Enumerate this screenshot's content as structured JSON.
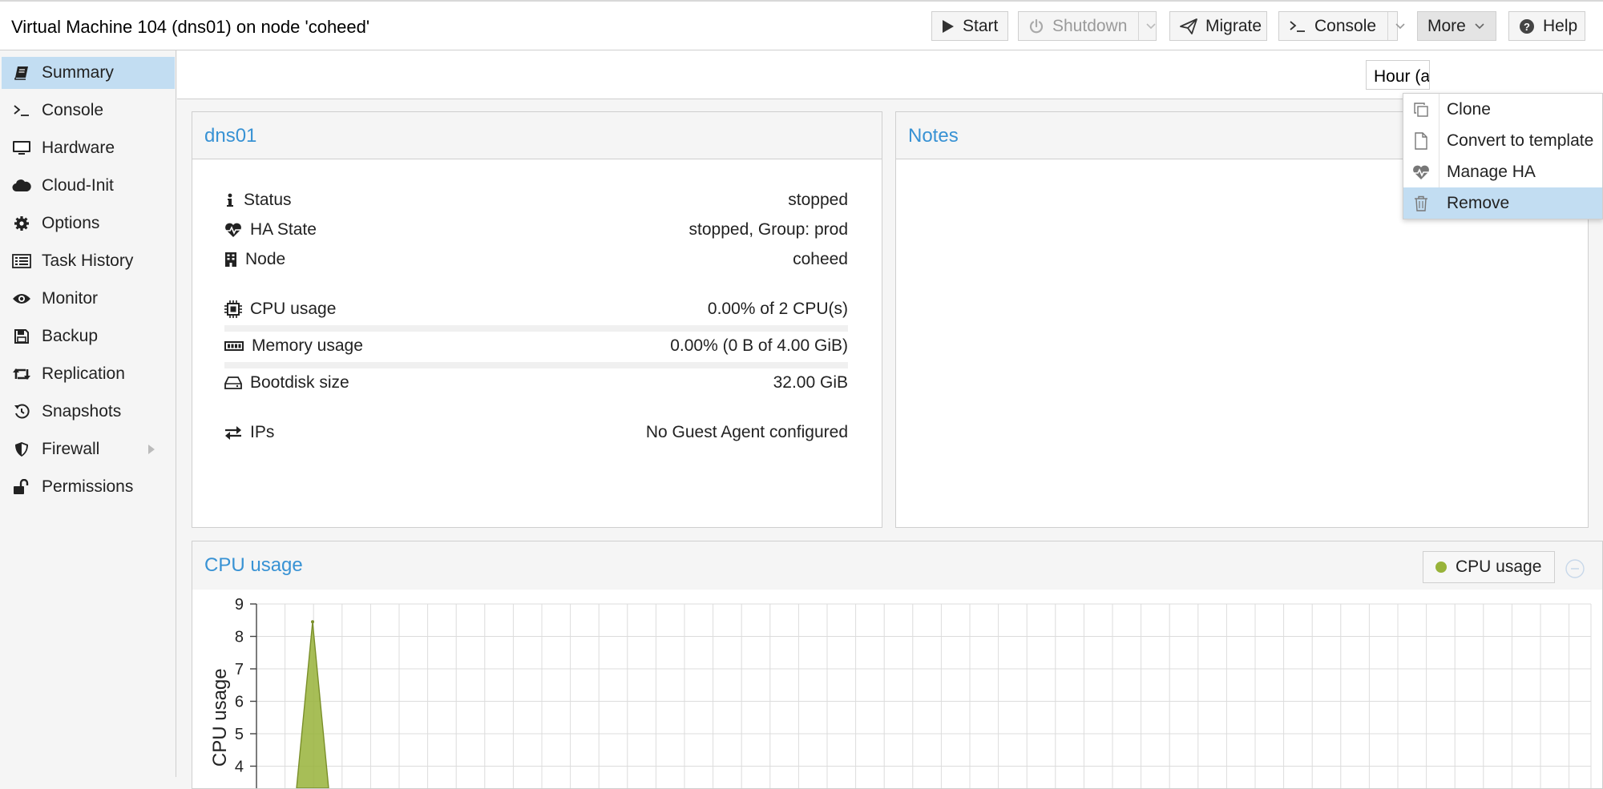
{
  "header": {
    "title": "Virtual Machine 104 (dns01) on node 'coheed'",
    "buttons": {
      "start": "Start",
      "shutdown": "Shutdown",
      "migrate": "Migrate",
      "console": "Console",
      "more": "More",
      "help": "Help"
    }
  },
  "sidebar": {
    "items": [
      {
        "label": "Summary",
        "icon": "book-icon"
      },
      {
        "label": "Console",
        "icon": "terminal-icon"
      },
      {
        "label": "Hardware",
        "icon": "monitor-icon"
      },
      {
        "label": "Cloud-Init",
        "icon": "cloud-icon"
      },
      {
        "label": "Options",
        "icon": "gear-icon"
      },
      {
        "label": "Task History",
        "icon": "list-icon"
      },
      {
        "label": "Monitor",
        "icon": "eye-icon"
      },
      {
        "label": "Backup",
        "icon": "floppy-icon"
      },
      {
        "label": "Replication",
        "icon": "retweet-icon"
      },
      {
        "label": "Snapshots",
        "icon": "history-icon"
      },
      {
        "label": "Firewall",
        "icon": "shield-icon"
      },
      {
        "label": "Permissions",
        "icon": "unlock-icon"
      }
    ],
    "active_index": 0
  },
  "toolbar": {
    "timeframe": "Hour (average)"
  },
  "status_panel": {
    "title": "dns01",
    "rows": {
      "status": {
        "label": "Status",
        "value": "stopped"
      },
      "ha_state": {
        "label": "HA State",
        "value": "stopped, Group: prod"
      },
      "node": {
        "label": "Node",
        "value": "coheed"
      },
      "cpu": {
        "label": "CPU usage",
        "value": "0.00% of 2 CPU(s)"
      },
      "memory": {
        "label": "Memory usage",
        "value": "0.00% (0 B of 4.00 GiB)"
      },
      "bootdisk": {
        "label": "Bootdisk size",
        "value": "32.00 GiB"
      },
      "ips": {
        "label": "IPs",
        "value": "No Guest Agent configured"
      }
    }
  },
  "notes_panel": {
    "title": "Notes"
  },
  "more_menu": {
    "items": [
      {
        "label": "Clone",
        "icon": "clone-icon"
      },
      {
        "label": "Convert to template",
        "icon": "file-icon"
      },
      {
        "label": "Manage HA",
        "icon": "heartbeat-icon"
      },
      {
        "label": "Remove",
        "icon": "trash-icon"
      }
    ],
    "highlighted": "Remove"
  },
  "cpu_chart": {
    "title": "CPU usage",
    "legend": "CPU usage",
    "series_color": "#98b33a"
  },
  "chart_data": {
    "type": "area",
    "title": "CPU usage",
    "xlabel": "",
    "ylabel": "CPU usage",
    "yticks": [
      4,
      5,
      6,
      7,
      8,
      9
    ],
    "ylim_visible": [
      3.6,
      9
    ],
    "series": [
      {
        "name": "CPU usage",
        "color": "#98b33a",
        "x": [
          0,
          1,
          2,
          3,
          4,
          5,
          6,
          7,
          8
        ],
        "values": [
          0,
          0,
          0,
          0,
          8.45,
          0,
          0,
          0,
          0
        ]
      }
    ],
    "grid": true,
    "legend": "top-right"
  }
}
